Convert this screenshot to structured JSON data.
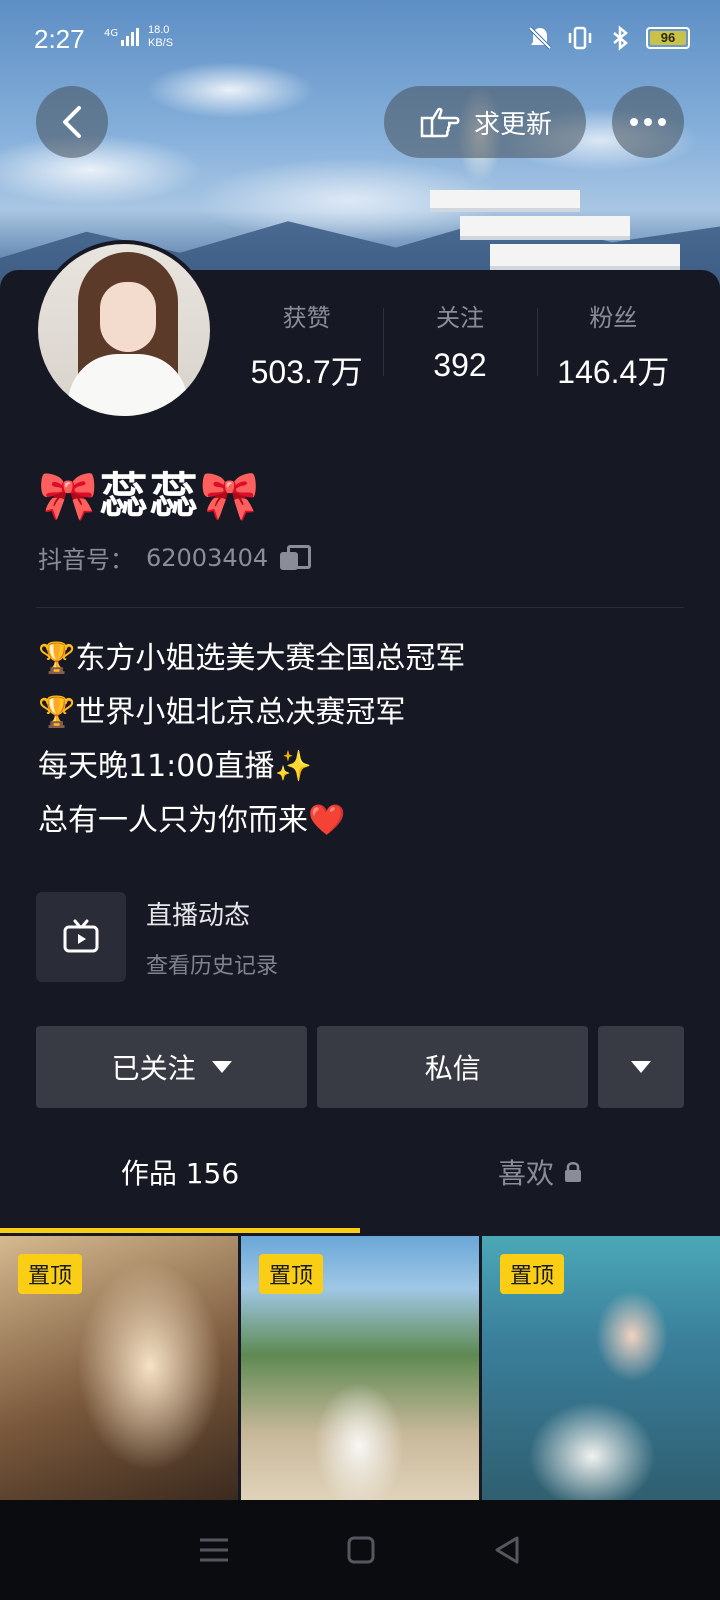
{
  "status_bar": {
    "time": "2:27",
    "network": "4G",
    "speed_value": "18.0",
    "speed_unit": "KB/S",
    "battery": "96"
  },
  "top_bar": {
    "update_label": "求更新"
  },
  "profile": {
    "name": "🎀蕊蕊🎀",
    "id_label": "抖音号：",
    "id_value": "62003404",
    "stats": [
      {
        "label": "获赞",
        "value": "503.7万"
      },
      {
        "label": "关注",
        "value": "392"
      },
      {
        "label": "粉丝",
        "value": "146.4万"
      }
    ],
    "bio_lines": [
      "🏆东方小姐选美大赛全国总冠军",
      "🏆世界小姐北京总决赛冠军",
      "每天晚11:00直播✨",
      "总有一人只为你而来❤️"
    ]
  },
  "live_card": {
    "title": "直播动态",
    "subtitle": "查看历史记录"
  },
  "actions": {
    "follow_label": "已关注",
    "message_label": "私信"
  },
  "tabs": {
    "works_label": "作品",
    "works_count": "156",
    "likes_label": "喜欢"
  },
  "grid": {
    "pin_label": "置顶"
  },
  "colors": {
    "background": "#161823",
    "accent": "#face15",
    "button": "#393b44"
  }
}
